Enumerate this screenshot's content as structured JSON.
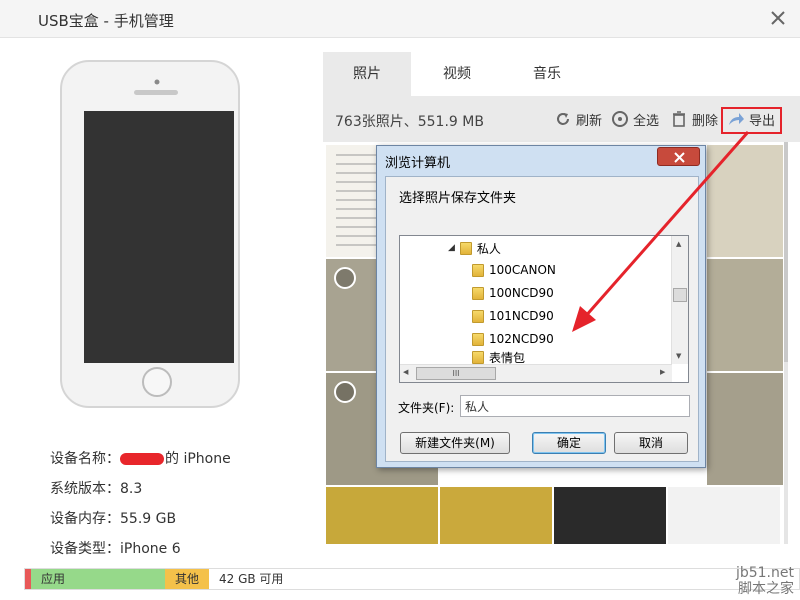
{
  "window": {
    "title": "USB宝盒 - 手机管理"
  },
  "device": {
    "name_label": "设备名称：",
    "name_suffix": "的 iPhone",
    "version_label": "系统版本：",
    "version": "8.3",
    "memory_label": "设备内存：",
    "memory": "55.9 GB",
    "type_label": "设备类型：",
    "type": "iPhone 6"
  },
  "storage": {
    "app": "应用",
    "other": "其他",
    "free": "42 GB 可用"
  },
  "tabs": [
    {
      "label": "照片"
    },
    {
      "label": "视频"
    },
    {
      "label": "音乐"
    }
  ],
  "toolbar": {
    "count": "763张照片、551.9 MB",
    "refresh": "刷新",
    "select_all": "全选",
    "delete": "删除",
    "export": "导出"
  },
  "dialog": {
    "title": "浏览计算机",
    "prompt": "选择照片保存文件夹",
    "tree": [
      "私人",
      "100CANON",
      "100NCD90",
      "101NCD90",
      "102NCD90",
      "表情包"
    ],
    "scroll_marks": "III",
    "folder_label": "文件夹(F):",
    "folder_value": "私人",
    "new_folder": "新建文件夹(M)",
    "ok": "确定",
    "cancel": "取消"
  },
  "watermark": {
    "line1": "jb51.net",
    "line2": "脚本之家"
  },
  "colors": {
    "accent_red": "#e5232b",
    "app_bar": "#96d98a",
    "other_bar": "#f4c14a"
  }
}
